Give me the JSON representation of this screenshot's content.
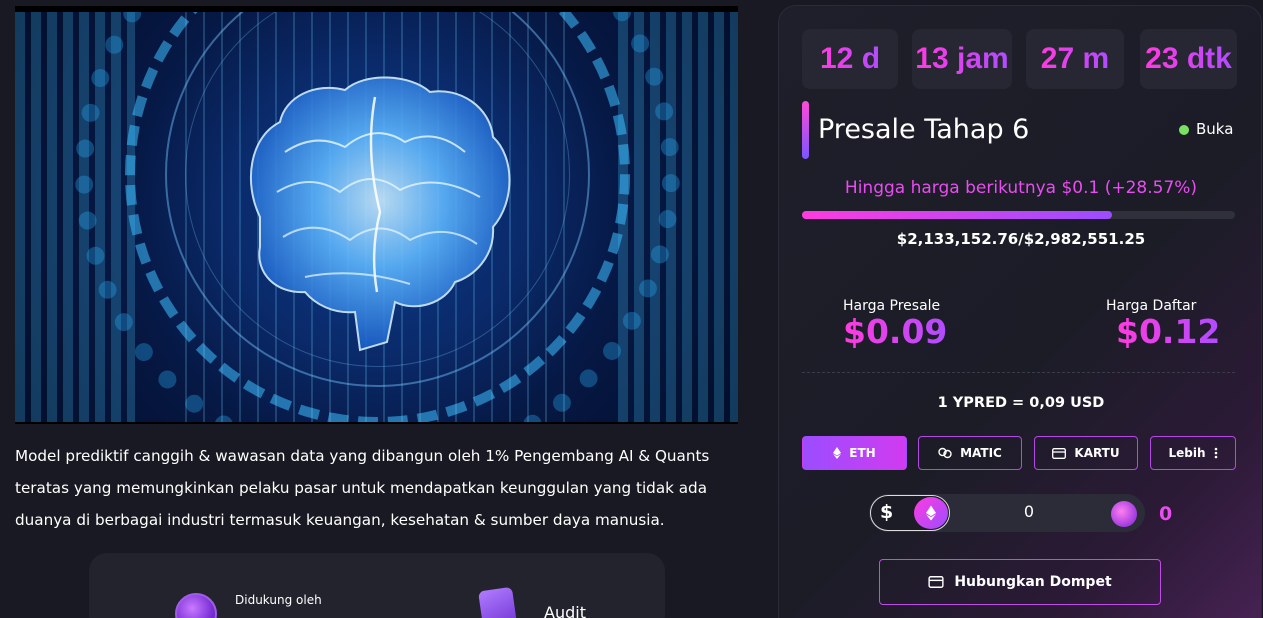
{
  "hero": {
    "alt": "AI brain visualization"
  },
  "description": "Model prediktif canggih & wawasan data yang dibangun oleh 1% Pengembang AI & Quants teratas yang memungkinkan pelaku pasar untuk mendapatkan keunggulan yang tidak ada duanya di berbagai industri termasuk keuangan, kesehatan & sumber daya manusia.",
  "support": {
    "label": "Didukung oleh",
    "audit_label": "Audit"
  },
  "presale": {
    "timer": {
      "days": "12 d",
      "hours": "13 jam",
      "minutes": "27 m",
      "seconds": "23 dtk"
    },
    "stage_title": "Presale Tahap 6",
    "status": "Buka",
    "status_color": "#7ae05f",
    "next_price_text": "Hingga harga berikutnya $0.1 (+28.57%)",
    "progress_fraction": 0.7153,
    "raised_text": "$2,133,152.76/$2,982,551.25",
    "presale_price_label": "Harga Presale",
    "presale_price": "$0.09",
    "list_price_label": "Harga Daftar",
    "list_price": "$0.12",
    "rate_text": "1 YPRED = 0,09 USD",
    "pay_methods": [
      {
        "label": "ETH",
        "icon": "eth-icon",
        "active": true
      },
      {
        "label": "MATIC",
        "icon": "link-icon",
        "active": false
      },
      {
        "label": "KARTU",
        "icon": "card-icon",
        "active": false
      },
      {
        "label": "Lebih",
        "icon": "more-vertical-icon",
        "active": false
      }
    ],
    "currency_symbol": "$",
    "amount_value": "0",
    "token_amount": "0",
    "connect_label": "Hubungkan Dompet"
  },
  "colors": {
    "accent_pink": "#ff3be0",
    "accent_purple": "#9b4dff",
    "background": "#181922"
  }
}
